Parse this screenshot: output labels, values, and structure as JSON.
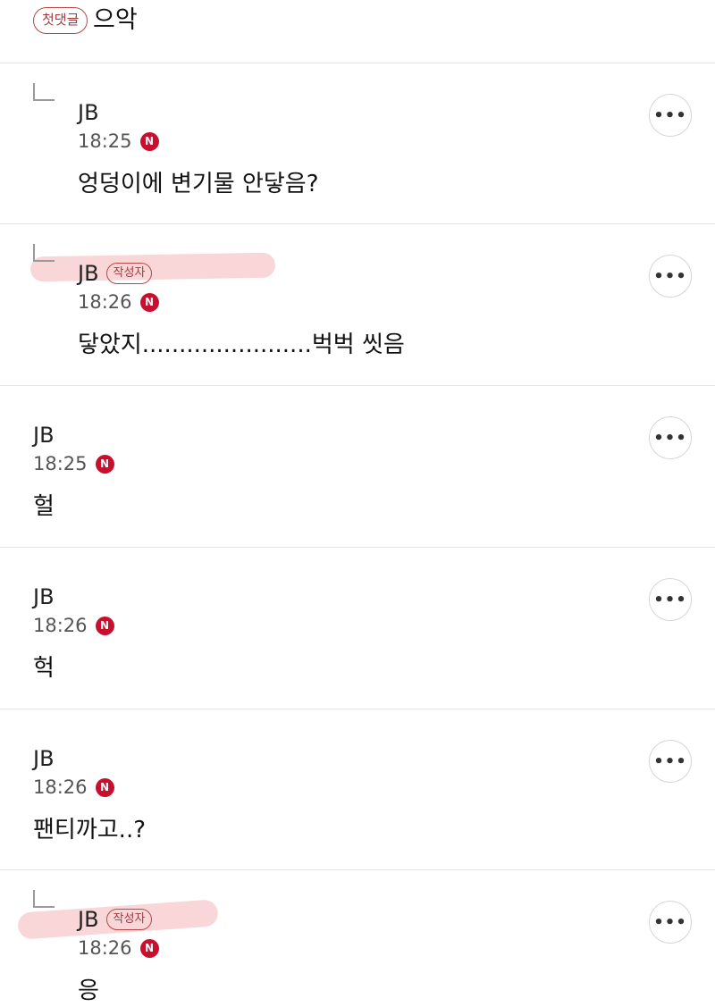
{
  "top": {
    "badge": "첫댓글",
    "text": "으악"
  },
  "comments": [
    {
      "author": "JB",
      "time": "18:25",
      "body": "엉덩이에 변기물 안닿음?",
      "author_badge": ""
    },
    {
      "author": "JB",
      "time": "18:26",
      "body": "닿았지.......................벅벅 씻음",
      "author_badge": "작성자"
    },
    {
      "author": "JB",
      "time": "18:25",
      "body": "헐",
      "author_badge": ""
    },
    {
      "author": "JB",
      "time": "18:26",
      "body": "헉",
      "author_badge": ""
    },
    {
      "author": "JB",
      "time": "18:26",
      "body": "팬티까고..?",
      "author_badge": ""
    },
    {
      "author": "JB",
      "time": "18:26",
      "body": "응",
      "author_badge": "작성자"
    }
  ],
  "icons": {
    "new": "N",
    "more": "•••"
  },
  "colors": {
    "badge_red": "#a33a3e",
    "new_icon": "#c8102e",
    "highlight": "#f7c9cb"
  }
}
